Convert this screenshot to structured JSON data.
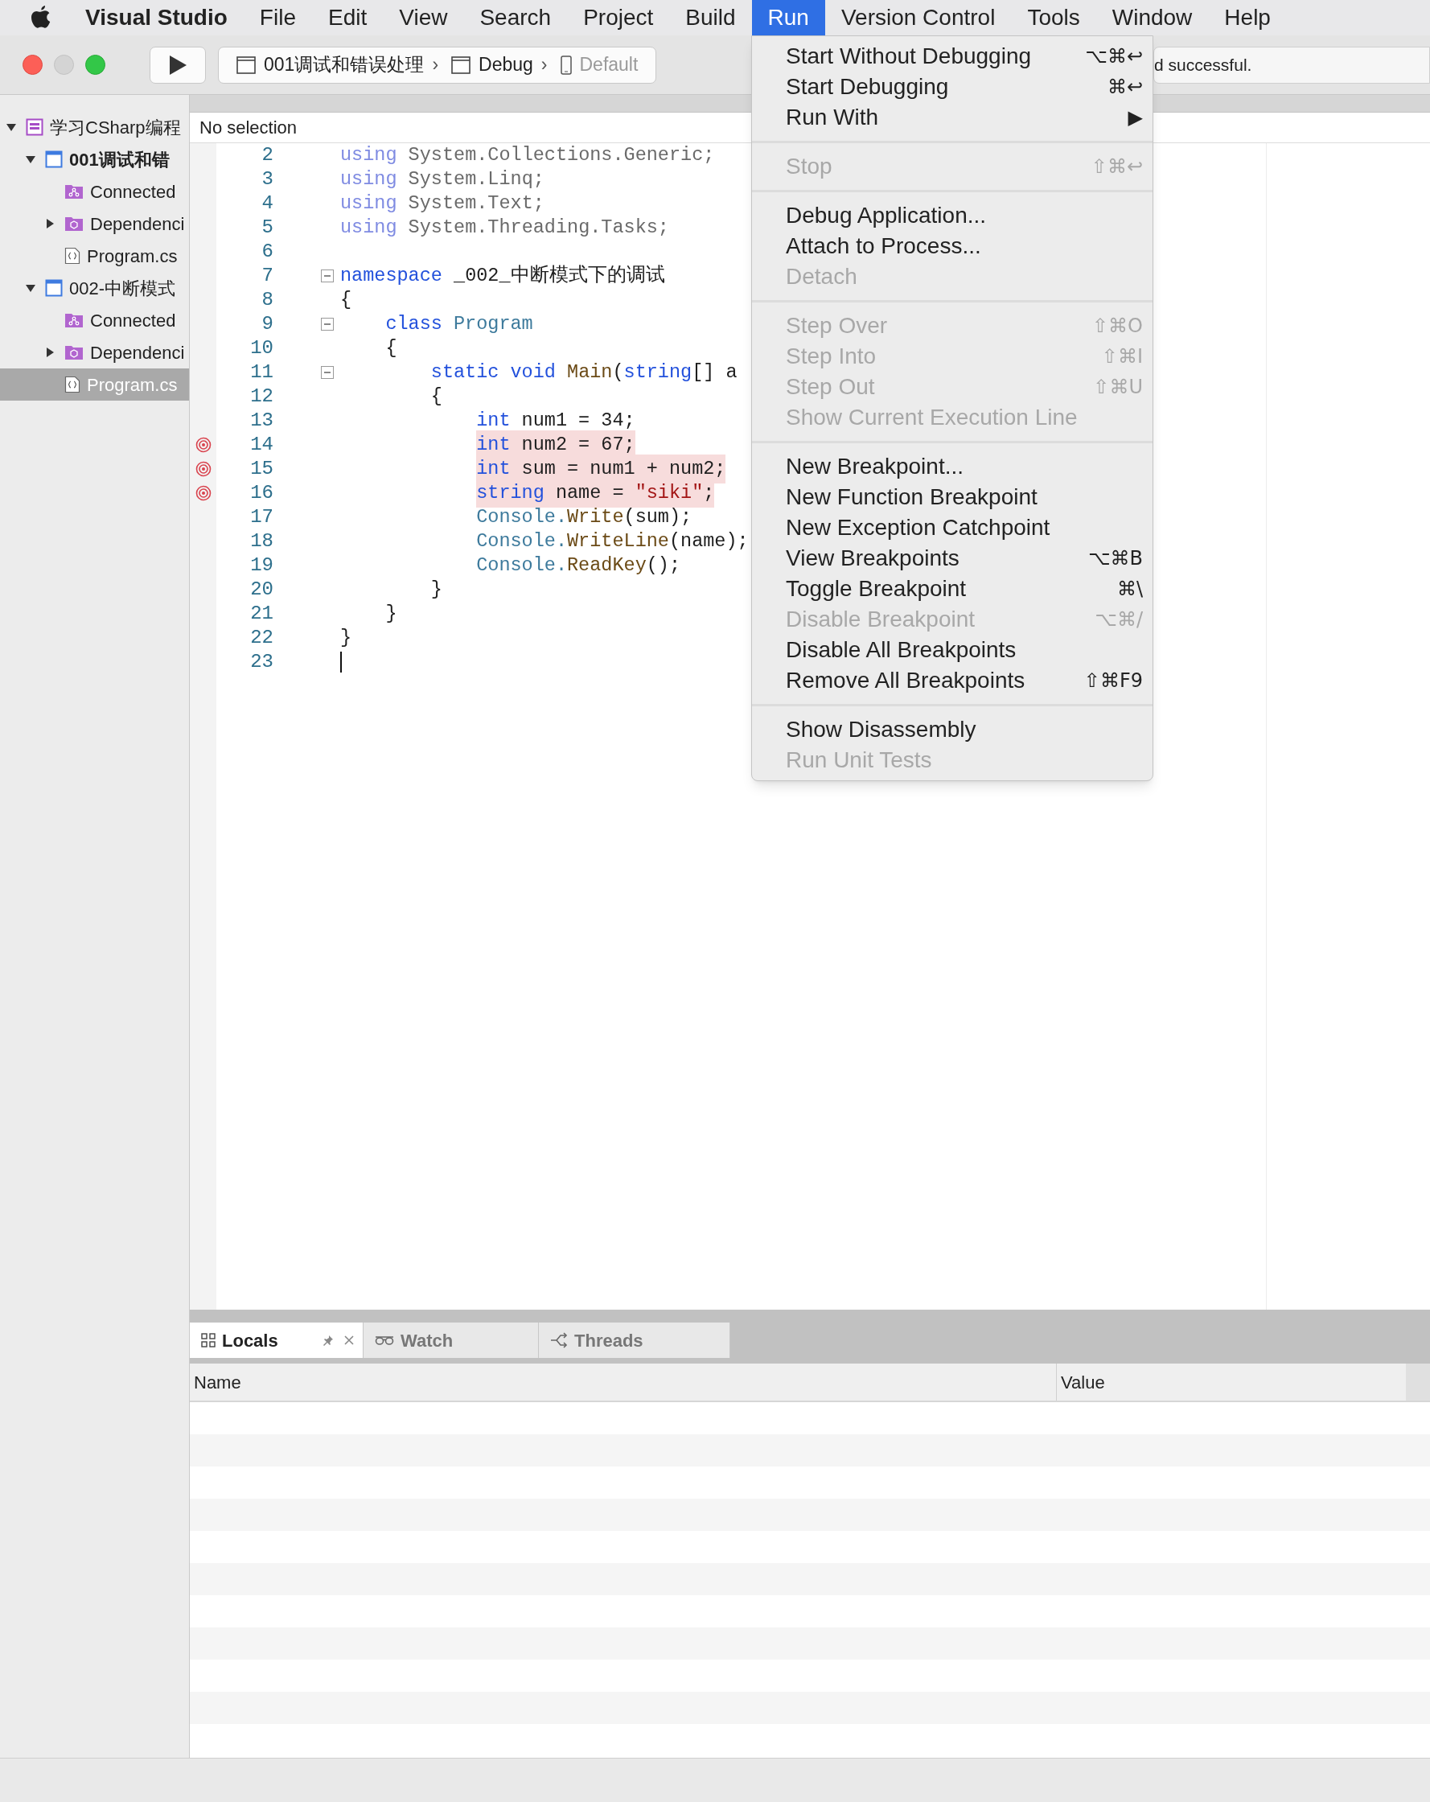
{
  "menu_bar": {
    "items": [
      {
        "label": "Visual Studio",
        "kind": "app",
        "selected": false
      },
      {
        "label": "File",
        "kind": "menu",
        "selected": false
      },
      {
        "label": "Edit",
        "kind": "menu",
        "selected": false
      },
      {
        "label": "View",
        "kind": "menu",
        "selected": false
      },
      {
        "label": "Search",
        "kind": "menu",
        "selected": false
      },
      {
        "label": "Project",
        "kind": "menu",
        "selected": false
      },
      {
        "label": "Build",
        "kind": "menu",
        "selected": false
      },
      {
        "label": "Run",
        "kind": "menu",
        "selected": true
      },
      {
        "label": "Version Control",
        "kind": "menu",
        "selected": false
      },
      {
        "label": "Tools",
        "kind": "menu",
        "selected": false
      },
      {
        "label": "Window",
        "kind": "menu",
        "selected": false
      },
      {
        "label": "Help",
        "kind": "menu",
        "selected": false
      }
    ]
  },
  "toolbar": {
    "breadcrumb": [
      {
        "label": "001调试和错误处理",
        "kind": "project",
        "disabled": false,
        "separator": "›"
      },
      {
        "label": "Debug",
        "kind": "config",
        "disabled": false,
        "separator": "›"
      },
      {
        "label": "Default",
        "kind": "device",
        "disabled": true
      }
    ],
    "status": "d successful."
  },
  "solution_tree": [
    {
      "label": "学习CSharp编程",
      "kind": "solution",
      "expanded": true,
      "selected": false,
      "children": [
        {
          "label": "001调试和错",
          "kind": "project",
          "startup": true,
          "expanded": true,
          "selected": false,
          "children": [
            {
              "label": "Connected",
              "kind": "connected",
              "selected": false
            },
            {
              "label": "Dependenci",
              "kind": "dependencies",
              "expanded": false,
              "selected": false
            },
            {
              "label": "Program.cs",
              "kind": "file",
              "selected": false
            }
          ]
        },
        {
          "label": "002-中断模式",
          "kind": "project",
          "startup": false,
          "expanded": true,
          "selected": false,
          "children": [
            {
              "label": "Connected",
              "kind": "connected",
              "selected": false
            },
            {
              "label": "Dependenci",
              "kind": "dependencies",
              "expanded": false,
              "selected": false
            },
            {
              "label": "Program.cs",
              "kind": "file",
              "selected": true
            }
          ]
        }
      ]
    }
  ],
  "editor": {
    "path_bar": "No selection",
    "lines": [
      {
        "number": "2",
        "faded": true,
        "tokens": [
          {
            "kind": "kw",
            "text": "using"
          },
          {
            "kind": "plain",
            "text": " System.Collections.Generic;"
          }
        ]
      },
      {
        "number": "3",
        "faded": true,
        "tokens": [
          {
            "kind": "kw",
            "text": "using"
          },
          {
            "kind": "plain",
            "text": " System.Linq;"
          }
        ]
      },
      {
        "number": "4",
        "faded": true,
        "tokens": [
          {
            "kind": "kw",
            "text": "using"
          },
          {
            "kind": "plain",
            "text": " System.Text;"
          }
        ]
      },
      {
        "number": "5",
        "faded": true,
        "tokens": [
          {
            "kind": "kw",
            "text": "using"
          },
          {
            "kind": "plain",
            "text": " System.Threading.Tasks;"
          }
        ]
      },
      {
        "number": "6"
      },
      {
        "number": "7",
        "fold": true,
        "tokens": [
          {
            "kind": "kw",
            "text": "namespace"
          },
          {
            "kind": "plain",
            "text": " _002_中断模式下的调试"
          }
        ]
      },
      {
        "number": "8",
        "tokens": [
          {
            "kind": "plain",
            "text": "{"
          }
        ]
      },
      {
        "number": "9",
        "fold": true,
        "tokens": [
          {
            "kind": "kw",
            "text": "class"
          },
          {
            "kind": "type",
            "text": " Program"
          }
        ]
      },
      {
        "number": "10",
        "tokens": [
          {
            "kind": "plain",
            "text": "{"
          }
        ]
      },
      {
        "number": "11",
        "fold": true,
        "tokens": [
          {
            "kind": "kw",
            "text": "static void"
          },
          {
            "kind": "method",
            "text": " Main"
          },
          {
            "kind": "plain",
            "text": "("
          },
          {
            "kind": "kw",
            "text": "string"
          },
          {
            "kind": "plain",
            "text": "[] a"
          }
        ]
      },
      {
        "number": "12",
        "tokens": [
          {
            "kind": "plain",
            "text": "{"
          }
        ]
      },
      {
        "number": "13",
        "tokens": [
          {
            "kind": "kw",
            "text": "int"
          },
          {
            "kind": "plain",
            "text": " num1 = 34;"
          }
        ]
      },
      {
        "number": "14",
        "breakpoint": true,
        "tokens": [
          {
            "kind": "kw",
            "text": "int"
          },
          {
            "kind": "plain",
            "text": " num2 = 67;"
          }
        ]
      },
      {
        "number": "15",
        "breakpoint": true,
        "tokens": [
          {
            "kind": "kw",
            "text": "int"
          },
          {
            "kind": "plain",
            "text": " sum = num1 + num2;"
          }
        ]
      },
      {
        "number": "16",
        "breakpoint": true,
        "tokens": [
          {
            "kind": "kw",
            "text": "string"
          },
          {
            "kind": "plain",
            "text": " name = "
          },
          {
            "kind": "string",
            "text": "\"siki\""
          },
          {
            "kind": "plain",
            "text": ";"
          }
        ]
      },
      {
        "number": "17",
        "tokens": [
          {
            "kind": "type",
            "text": "Console."
          },
          {
            "kind": "method",
            "text": "Write"
          },
          {
            "kind": "plain",
            "text": "(sum);"
          }
        ]
      },
      {
        "number": "18",
        "tokens": [
          {
            "kind": "type",
            "text": "Console."
          },
          {
            "kind": "method",
            "text": "WriteLine"
          },
          {
            "kind": "plain",
            "text": "(name);"
          }
        ]
      },
      {
        "number": "19",
        "tokens": [
          {
            "kind": "type",
            "text": "Console."
          },
          {
            "kind": "method",
            "text": "ReadKey"
          },
          {
            "kind": "plain",
            "text": "();"
          }
        ]
      },
      {
        "number": "20",
        "tokens": [
          {
            "kind": "plain",
            "text": "}"
          }
        ]
      },
      {
        "number": "21",
        "tokens": [
          {
            "kind": "plain",
            "text": "}"
          }
        ]
      },
      {
        "number": "22",
        "tokens": [
          {
            "kind": "plain",
            "text": "}"
          }
        ]
      },
      {
        "number": "23",
        "caret": true
      }
    ]
  },
  "run_menu": {
    "sections": [
      [
        {
          "label": "Start Without Debugging",
          "shortcut": "⌥⌘↩",
          "disabled": false
        },
        {
          "label": "Start Debugging",
          "shortcut": "⌘↩",
          "disabled": false
        },
        {
          "label": "Run With",
          "shortcut": "▶",
          "disabled": false
        }
      ],
      [
        {
          "label": "Stop",
          "shortcut": "⇧⌘↩",
          "disabled": true
        }
      ],
      [
        {
          "label": "Debug Application...",
          "disabled": false
        },
        {
          "label": "Attach to Process...",
          "disabled": false
        },
        {
          "label": "Detach",
          "disabled": true
        }
      ],
      [
        {
          "label": "Step Over",
          "shortcut": "⇧⌘O",
          "disabled": true
        },
        {
          "label": "Step Into",
          "shortcut": "⇧⌘I",
          "disabled": true
        },
        {
          "label": "Step Out",
          "shortcut": "⇧⌘U",
          "disabled": true
        },
        {
          "label": "Show Current Execution Line",
          "disabled": true
        }
      ],
      [
        {
          "label": "New Breakpoint...",
          "disabled": false
        },
        {
          "label": "New Function Breakpoint",
          "disabled": false
        },
        {
          "label": "New Exception Catchpoint",
          "disabled": false
        },
        {
          "label": "View Breakpoints",
          "shortcut": "⌥⌘B",
          "disabled": false
        },
        {
          "label": "Toggle Breakpoint",
          "shortcut": "⌘\\",
          "disabled": false
        },
        {
          "label": "Disable Breakpoint",
          "shortcut": "⌥⌘/",
          "disabled": true
        },
        {
          "label": "Disable All Breakpoints",
          "disabled": false
        },
        {
          "label": "Remove All Breakpoints",
          "shortcut": "⇧⌘F9",
          "disabled": false
        }
      ],
      [
        {
          "label": "Show Disassembly",
          "disabled": false
        },
        {
          "label": "Run Unit Tests",
          "disabled": true
        }
      ]
    ]
  },
  "pad": {
    "tabs": [
      {
        "label": "Locals",
        "kind": "locals",
        "selected": true
      },
      {
        "label": "Watch",
        "kind": "watch",
        "selected": false
      },
      {
        "label": "Threads",
        "kind": "threads",
        "selected": false
      }
    ],
    "columns": [
      "Name",
      "Value"
    ]
  }
}
